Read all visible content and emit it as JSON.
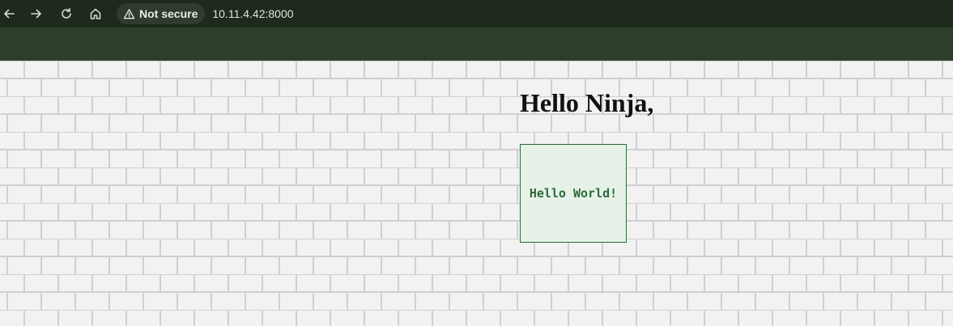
{
  "browser": {
    "security_label": "Not secure",
    "url": "10.11.4.42:8000"
  },
  "page": {
    "greeting": "Hello Ninja,",
    "box_text": "Hello World!"
  },
  "colors": {
    "toolbar": "#1e2a1c",
    "bookmarks_bar": "#2f3e2b",
    "page_background": "#f2f2f2",
    "brick_lines": "#cfcfd6",
    "box_background": "#e6f2e8",
    "box_accent": "#2e6a3a"
  },
  "icons": [
    "back-arrow-icon",
    "forward-arrow-icon",
    "reload-icon",
    "home-icon",
    "warning-icon"
  ]
}
